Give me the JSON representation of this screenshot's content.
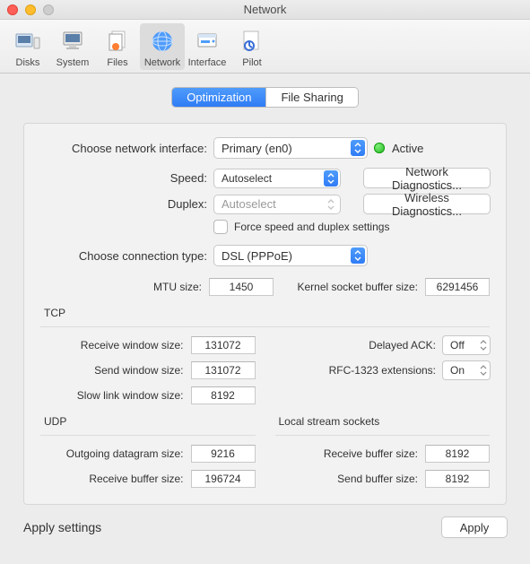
{
  "window": {
    "title": "Network"
  },
  "toolbar": {
    "items": [
      {
        "label": "Disks"
      },
      {
        "label": "System"
      },
      {
        "label": "Files"
      },
      {
        "label": "Network"
      },
      {
        "label": "Interface"
      },
      {
        "label": "Pilot"
      }
    ]
  },
  "tabs": {
    "optimization": "Optimization",
    "filesharing": "File Sharing"
  },
  "labels": {
    "choose_if": "Choose network interface:",
    "active": "Active",
    "speed": "Speed:",
    "duplex": "Duplex:",
    "force": "Force speed and duplex settings",
    "conn_type": "Choose connection type:",
    "mtu": "MTU size:",
    "kbuf": "Kernel socket buffer size:",
    "tcp": "TCP",
    "rwin": "Receive window size:",
    "swin": "Send window size:",
    "slowwin": "Slow link window size:",
    "dack": "Delayed ACK:",
    "rfc": "RFC-1323 extensions:",
    "udp": "UDP",
    "lss": "Local stream sockets",
    "odg": "Outgoing datagram size:",
    "rbuf": "Receive buffer size:",
    "sbuf": "Send buffer size:",
    "apply_settings": "Apply settings",
    "apply": "Apply",
    "netdiag": "Network Diagnostics...",
    "wifidiag": "Wireless Diagnostics..."
  },
  "values": {
    "interface": "Primary (en0)",
    "speed": "Autoselect",
    "duplex": "Autoselect",
    "conn_type": "DSL (PPPoE)",
    "mtu": "1450",
    "kbuf": "6291456",
    "rwin": "131072",
    "swin": "131072",
    "slowwin": "8192",
    "dack": "Off",
    "rfc": "On",
    "odg": "9216",
    "udp_rbuf": "196724",
    "lss_rbuf": "8192",
    "lss_sbuf": "8192"
  }
}
